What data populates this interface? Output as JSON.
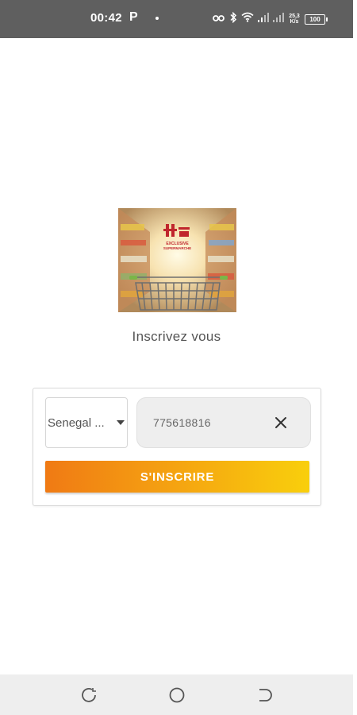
{
  "status_bar": {
    "time": "00:42",
    "notification_letter": "P",
    "speed_value": "25,3",
    "speed_unit": "K/s",
    "battery": "100"
  },
  "logo": {
    "icon": "shopping-cart-aisle-logo",
    "text": "EXCLUSIVE SUPERMARCHE"
  },
  "title": "Inscrivez vous",
  "form": {
    "country_selected": "Senegal ...",
    "phone_value": "775618816",
    "submit_label": "S'INSCRIRE"
  },
  "nav_bar": {
    "recents_icon": "recents-icon",
    "home_icon": "home-icon",
    "back_icon": "back-icon"
  },
  "colors": {
    "status_bar": "#5f5f5f",
    "button_gradient_start": "#f07a14",
    "button_gradient_end": "#f9cf0c",
    "nav_bar": "#eeeeee"
  }
}
